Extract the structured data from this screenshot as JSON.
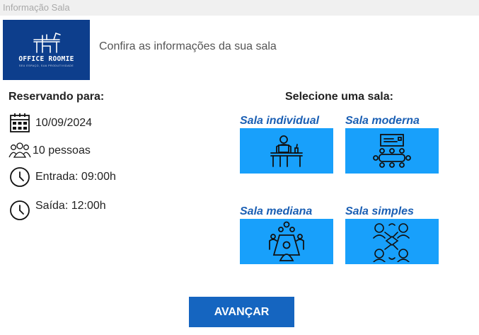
{
  "window": {
    "title": "Informação Sala"
  },
  "header": {
    "logo": {
      "brand": "OFFICE ROOMIE",
      "slogan": "SEU ESPAÇO, SUA PRODUTIVIDADE",
      "icon": "desk-chair-logo-icon"
    },
    "text": "Confira as informações da sua sala"
  },
  "reservation": {
    "title": "Reservando para:",
    "date": {
      "icon": "calendar-icon",
      "value": "10/09/2024"
    },
    "people": {
      "icon": "people-group-icon",
      "value": "10 pessoas"
    },
    "entry": {
      "icon": "clock-icon",
      "value": "Entrada: 09:00h"
    },
    "exit": {
      "icon": "clock-icon",
      "value": "Saída: 12:00h"
    }
  },
  "rooms": {
    "title": "Selecione uma sala:",
    "items": [
      {
        "label": "Sala individual",
        "icon": "person-at-desk-icon"
      },
      {
        "label": "Sala moderna",
        "icon": "meeting-screen-icon"
      },
      {
        "label": "Sala mediana",
        "icon": "meeting-table-icon"
      },
      {
        "label": "Sala simples",
        "icon": "people-circle-icon"
      }
    ]
  },
  "actions": {
    "next_label": "AVANÇAR"
  },
  "colors": {
    "brand": "#0d3e8c",
    "card": "#18a0fb",
    "button": "#1565c0",
    "room_title": "#1a5fb4"
  }
}
